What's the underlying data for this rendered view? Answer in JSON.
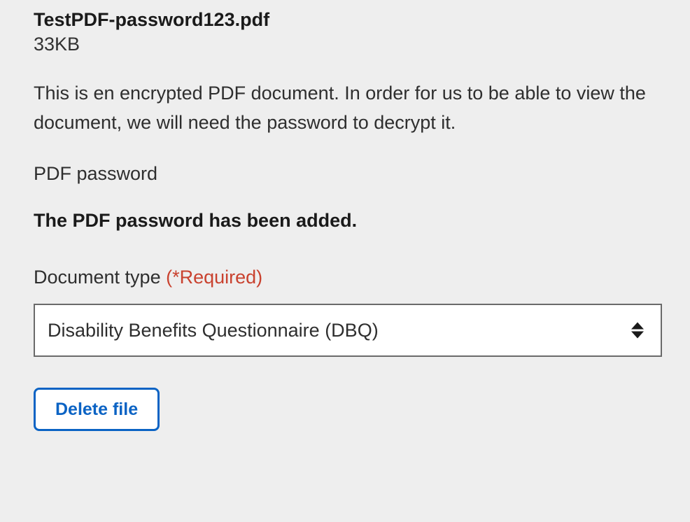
{
  "file": {
    "name": "TestPDF-password123.pdf",
    "size": "33KB"
  },
  "messages": {
    "encrypted": "This is en encrypted PDF document. In order for us to be able to view the document, we will need the password to decrypt it.",
    "password_label": "PDF password",
    "password_added": "The PDF password has been added."
  },
  "document_type": {
    "label": "Document type",
    "required_text": "(*Required)",
    "selected": "Disability Benefits Questionnaire (DBQ)"
  },
  "actions": {
    "delete": "Delete file"
  }
}
